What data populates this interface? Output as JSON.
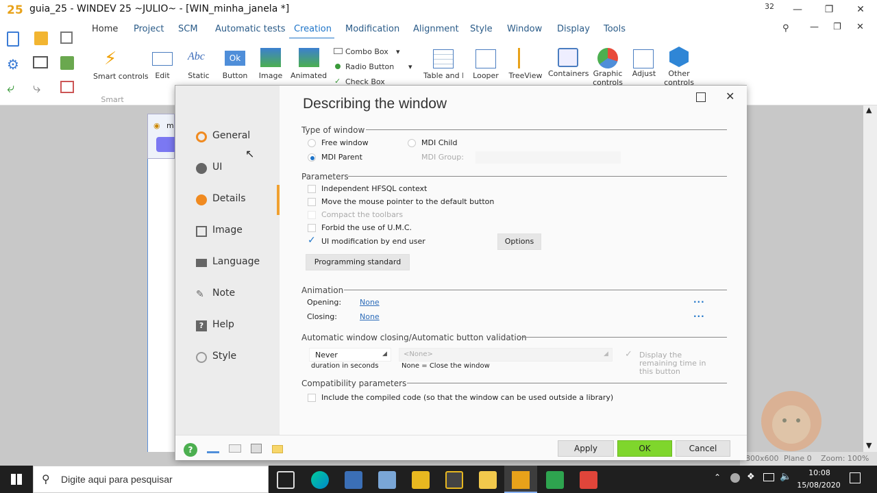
{
  "window": {
    "title": "guia_25 - WINDEV 25 ~JULIO~ - [WIN_minha_janela *]",
    "badge": "32"
  },
  "menu": [
    "Home",
    "Project",
    "SCM",
    "Automatic tests",
    "Creation",
    "Modification",
    "Alignment",
    "Style",
    "Window",
    "Display",
    "Tools"
  ],
  "ribbon": {
    "smart": "Smart",
    "smart_controls": "Smart controls",
    "edit": "Edit",
    "static": "Static",
    "static_icon": "Abc",
    "button": "Button",
    "button_icon": "Ok",
    "image": "Image",
    "animated": "Animated images",
    "combo": "Combo Box",
    "radio": "Radio Button",
    "check": "Check Box",
    "table": "Table and List Box",
    "looper": "Looper",
    "treeview": "TreeView",
    "containers": "Containers",
    "graphic": "Graphic controls",
    "adjust": "Adjust",
    "other": "Other controls"
  },
  "editor": {
    "tab_label": "m"
  },
  "dialog": {
    "title": "Describing the window",
    "nav": [
      "General",
      "UI",
      "Details",
      "Image",
      "Language",
      "Note",
      "Help",
      "Style"
    ],
    "type_section": "Type of window",
    "free_window": "Free window",
    "mdi_child": "MDI Child",
    "mdi_parent": "MDI Parent",
    "mdi_group": "MDI Group:",
    "params_section": "Parameters",
    "params": [
      "Independent HFSQL context",
      "Move the mouse pointer to the default button",
      "Compact the toolbars",
      "Forbid the use of U.M.C.",
      "UI modification by end user"
    ],
    "options_btn": "Options",
    "prog_std_btn": "Programming standard",
    "anim_section": "Animation",
    "opening": "Opening:",
    "closing": "Closing:",
    "none_link": "None",
    "dots": "...",
    "auto_section": "Automatic window closing/Automatic button validation",
    "never": "Never",
    "duration": "duration in seconds",
    "none_select": "<None>",
    "none_close": "None = Close the window",
    "display_remaining": "Display the remaining time in this button",
    "compat_section": "Compatibility parameters",
    "include_compiled": "Include the compiled code (so that the window can be used outside a library)",
    "apply": "Apply",
    "ok": "OK",
    "cancel": "Cancel"
  },
  "status": {
    "size": "800x600",
    "plane": "Plane 0",
    "zoom": "Zoom: 100%"
  },
  "taskbar": {
    "search_placeholder": "Digite aqui para pesquisar",
    "time": "10:08",
    "date": "15/08/2020"
  }
}
